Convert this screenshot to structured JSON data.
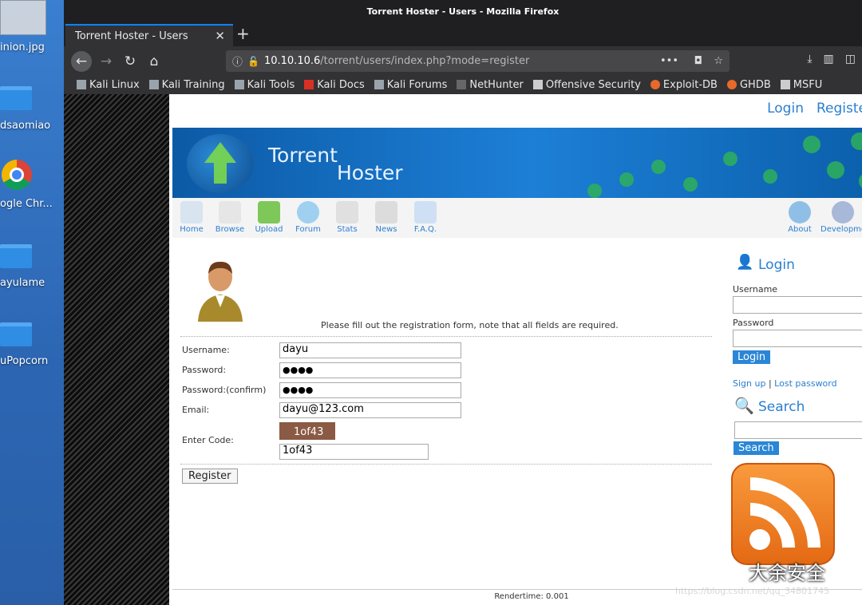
{
  "desktop": {
    "items": [
      {
        "label": "inion.jpg"
      },
      {
        "label": "dsaomiao"
      },
      {
        "label": "ogle Chr..."
      },
      {
        "label": "ayulame"
      },
      {
        "label": "uPopcorn"
      }
    ]
  },
  "window": {
    "title": "Torrent Hoster - Users - Mozilla Firefox",
    "tab_title": "Torrent Hoster - Users",
    "url_host": "10.10.10.6",
    "url_path": "/torrent/users/index.php?mode=register",
    "bookmarks": [
      {
        "label": "Kali Linux",
        "color": "#9aa3ab"
      },
      {
        "label": "Kali Training",
        "color": "#9aa3ab"
      },
      {
        "label": "Kali Tools",
        "color": "#9aa3ab"
      },
      {
        "label": "Kali Docs",
        "color": "#d93025"
      },
      {
        "label": "Kali Forums",
        "color": "#9aa3ab"
      },
      {
        "label": "NetHunter",
        "color": "#666666"
      },
      {
        "label": "Offensive Security",
        "color": "#cccccc"
      },
      {
        "label": "Exploit-DB",
        "color": "#e8692a"
      },
      {
        "label": "GHDB",
        "color": "#e8692a"
      },
      {
        "label": "MSFU",
        "color": "#cccccc"
      }
    ]
  },
  "site": {
    "top_links": {
      "login": "Login",
      "register": "Registe"
    },
    "banner": {
      "title_1": "Torrent",
      "title_2": "Hoster"
    },
    "menu": [
      {
        "label": "Home"
      },
      {
        "label": "Browse"
      },
      {
        "label": "Upload"
      },
      {
        "label": "Forum"
      },
      {
        "label": "Stats"
      },
      {
        "label": "News"
      },
      {
        "label": "F.A.Q."
      }
    ],
    "menu_right": [
      {
        "label": "About"
      },
      {
        "label": "Developme"
      }
    ],
    "form": {
      "intro": "Please fill out the registration form, note that all fields are required.",
      "username_label": "Username:",
      "username_value": "dayu",
      "password_label": "Password:",
      "password_value": "●●●●",
      "confirm_label": "Password:(confirm)",
      "confirm_value": "●●●●",
      "email_label": "Email:",
      "email_value": "dayu@123.com",
      "code_label": "Enter Code:",
      "captcha_text": "1of43",
      "code_value": "1of43",
      "register_button": "Register"
    },
    "sidebar": {
      "login_title": "Login",
      "username_label": "Username",
      "password_label": "Password",
      "login_button": "Login",
      "signup": "Sign up",
      "separator": "|",
      "lost_password": "Lost password",
      "search_title": "Search",
      "search_button": "Search"
    },
    "watermark": "大余安全",
    "csdn": "https://blog.csdn.net/qq_34801745",
    "footer": "Rendertime: 0.001"
  }
}
